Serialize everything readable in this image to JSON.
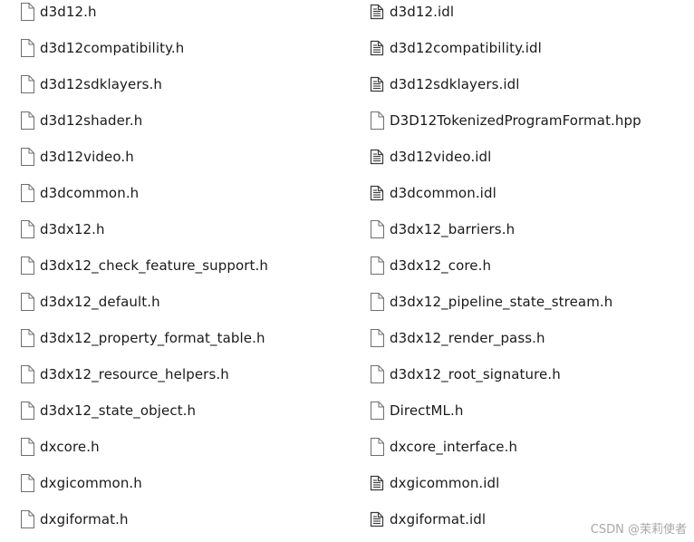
{
  "files": {
    "left": [
      {
        "name": "d3d12.h",
        "icon": "blank-file-icon"
      },
      {
        "name": "d3d12compatibility.h",
        "icon": "blank-file-icon"
      },
      {
        "name": "d3d12sdklayers.h",
        "icon": "blank-file-icon"
      },
      {
        "name": "d3d12shader.h",
        "icon": "blank-file-icon"
      },
      {
        "name": "d3d12video.h",
        "icon": "blank-file-icon"
      },
      {
        "name": "d3dcommon.h",
        "icon": "blank-file-icon"
      },
      {
        "name": "d3dx12.h",
        "icon": "blank-file-icon"
      },
      {
        "name": "d3dx12_check_feature_support.h",
        "icon": "blank-file-icon"
      },
      {
        "name": "d3dx12_default.h",
        "icon": "blank-file-icon"
      },
      {
        "name": "d3dx12_property_format_table.h",
        "icon": "blank-file-icon"
      },
      {
        "name": "d3dx12_resource_helpers.h",
        "icon": "blank-file-icon"
      },
      {
        "name": "d3dx12_state_object.h",
        "icon": "blank-file-icon"
      },
      {
        "name": "dxcore.h",
        "icon": "blank-file-icon"
      },
      {
        "name": "dxgicommon.h",
        "icon": "blank-file-icon"
      },
      {
        "name": "dxgiformat.h",
        "icon": "blank-file-icon"
      }
    ],
    "right": [
      {
        "name": "d3d12.idl",
        "icon": "text-file-icon"
      },
      {
        "name": "d3d12compatibility.idl",
        "icon": "text-file-icon"
      },
      {
        "name": "d3d12sdklayers.idl",
        "icon": "text-file-icon"
      },
      {
        "name": "D3D12TokenizedProgramFormat.hpp",
        "icon": "blank-file-icon"
      },
      {
        "name": "d3d12video.idl",
        "icon": "text-file-icon"
      },
      {
        "name": "d3dcommon.idl",
        "icon": "text-file-icon"
      },
      {
        "name": "d3dx12_barriers.h",
        "icon": "blank-file-icon"
      },
      {
        "name": "d3dx12_core.h",
        "icon": "blank-file-icon"
      },
      {
        "name": "d3dx12_pipeline_state_stream.h",
        "icon": "blank-file-icon"
      },
      {
        "name": "d3dx12_render_pass.h",
        "icon": "blank-file-icon"
      },
      {
        "name": "d3dx12_root_signature.h",
        "icon": "blank-file-icon"
      },
      {
        "name": "DirectML.h",
        "icon": "blank-file-icon"
      },
      {
        "name": "dxcore_interface.h",
        "icon": "blank-file-icon"
      },
      {
        "name": "dxgicommon.idl",
        "icon": "text-file-icon"
      },
      {
        "name": "dxgiformat.idl",
        "icon": "text-file-icon"
      }
    ]
  },
  "watermark": "CSDN @茉莉使者",
  "colors": {
    "text": "#1a1a1a",
    "icon_stroke": "#6e6e6e",
    "watermark": "#a8a8a8"
  }
}
